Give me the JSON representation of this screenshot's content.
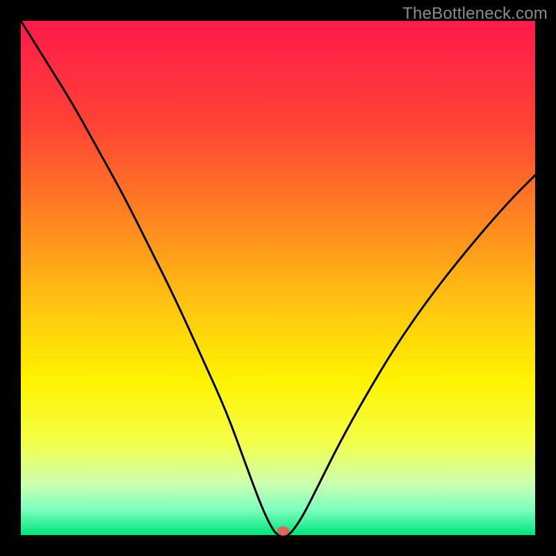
{
  "watermark": "TheBottleneck.com",
  "chart_data": {
    "type": "line",
    "title": "",
    "xlabel": "",
    "ylabel": "",
    "xlim": [
      0,
      100
    ],
    "ylim": [
      0,
      100
    ],
    "background": {
      "type": "vertical-gradient",
      "stops": [
        {
          "offset": 0.0,
          "color": "#ff1a4b"
        },
        {
          "offset": 0.2,
          "color": "#ff4236"
        },
        {
          "offset": 0.4,
          "color": "#ff8a1f"
        },
        {
          "offset": 0.55,
          "color": "#ffc411"
        },
        {
          "offset": 0.7,
          "color": "#fff300"
        },
        {
          "offset": 0.82,
          "color": "#f3ff4a"
        },
        {
          "offset": 0.9,
          "color": "#ccffb0"
        },
        {
          "offset": 0.95,
          "color": "#7dffc0"
        },
        {
          "offset": 1.0,
          "color": "#00e47a"
        }
      ]
    },
    "series": [
      {
        "name": "bottleneck-curve",
        "color": "#000000",
        "stroke_width": 3,
        "x": [
          0.0,
          5,
          10,
          15,
          20,
          25,
          30,
          35,
          40,
          44,
          47,
          49,
          50,
          51,
          52,
          53,
          55,
          58,
          62,
          67,
          73,
          80,
          88,
          95,
          100
        ],
        "y": [
          100,
          92,
          84,
          75,
          66,
          56,
          46,
          35,
          24,
          13,
          5,
          1,
          0,
          0,
          0,
          1,
          4,
          10,
          18,
          27,
          37,
          47,
          57,
          65,
          70
        ]
      }
    ],
    "marker": {
      "name": "optimum-point",
      "x": 51,
      "y": 0.8,
      "rx": 1.2,
      "ry": 0.9,
      "color": "#d9685c"
    }
  }
}
